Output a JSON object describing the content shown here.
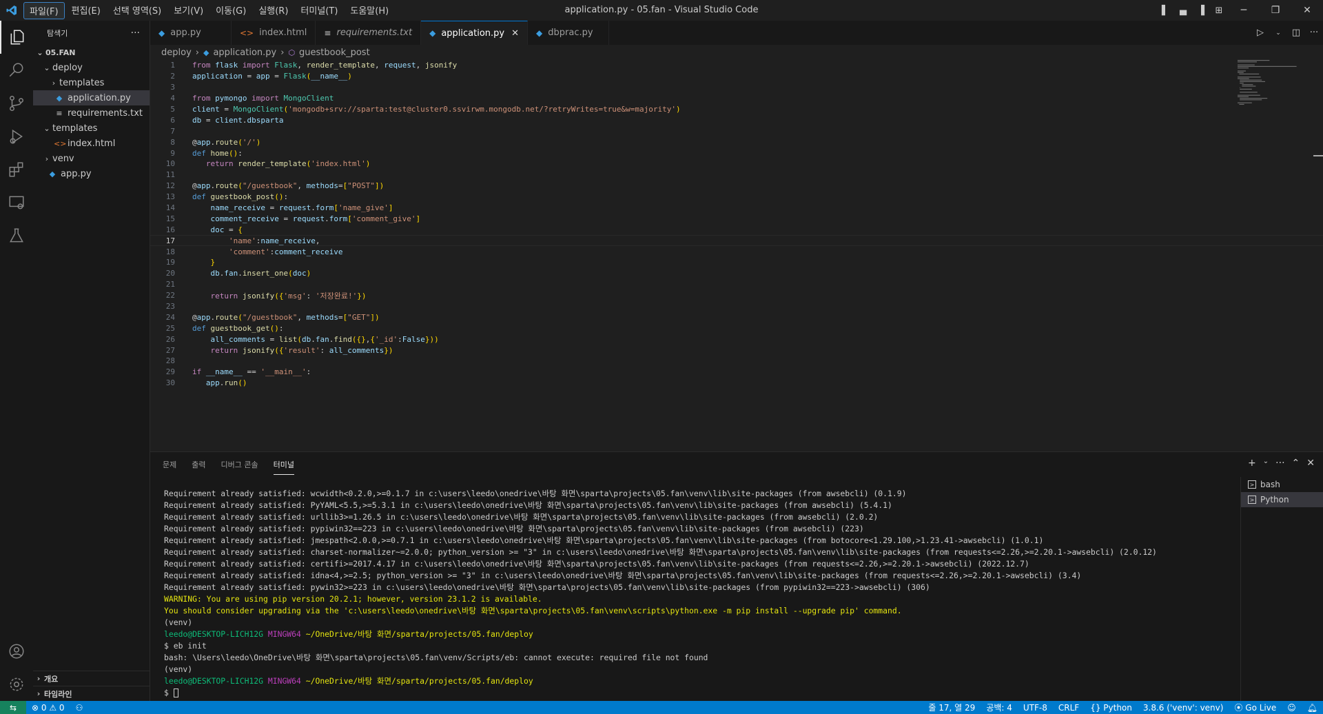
{
  "titlebar": {
    "menus": [
      "파일(F)",
      "편집(E)",
      "선택 영역(S)",
      "보기(V)",
      "이동(G)",
      "실행(R)",
      "터미널(T)",
      "도움말(H)"
    ],
    "window_title": "application.py - 05.fan - Visual Studio Code"
  },
  "sidebar": {
    "header": "탐색기",
    "more": "···",
    "root": "05.FAN",
    "items": [
      {
        "label": "deploy",
        "indent": 1,
        "kind": "folder-open"
      },
      {
        "label": "templates",
        "indent": 2,
        "kind": "folder-closed"
      },
      {
        "label": "application.py",
        "indent": 2,
        "kind": "python",
        "selected": true
      },
      {
        "label": "requirements.txt",
        "indent": 2,
        "kind": "text"
      },
      {
        "label": "templates",
        "indent": 1,
        "kind": "folder-open"
      },
      {
        "label": "index.html",
        "indent": 2,
        "kind": "html"
      },
      {
        "label": "venv",
        "indent": 1,
        "kind": "folder-closed"
      },
      {
        "label": "app.py",
        "indent": 1,
        "kind": "python"
      }
    ],
    "bottom_sections": [
      "개요",
      "타임라인"
    ]
  },
  "tabs": [
    {
      "label": "app.py",
      "kind": "python"
    },
    {
      "label": "index.html",
      "kind": "html"
    },
    {
      "label": "requirements.txt",
      "kind": "text"
    },
    {
      "label": "application.py",
      "kind": "python",
      "active": true
    },
    {
      "label": "dbprac.py",
      "kind": "python"
    }
  ],
  "breadcrumb": [
    "deploy",
    "application.py",
    "guestbook_post"
  ],
  "editor": {
    "current_line": 17,
    "lines": [
      "from flask import Flask, render_template, request, jsonify",
      "application = app = Flask(__name__)",
      "",
      "from pymongo import MongoClient",
      "client = MongoClient('mongodb+srv://sparta:test@cluster0.ssvirwm.mongodb.net/?retryWrites=true&w=majority')",
      "db = client.dbsparta",
      "",
      "@app.route('/')",
      "def home():",
      "   return render_template('index.html')",
      "",
      "@app.route(\"/guestbook\", methods=[\"POST\"])",
      "def guestbook_post():",
      "    name_receive = request.form['name_give']",
      "    comment_receive = request.form['comment_give']",
      "    doc = {",
      "        'name':name_receive,",
      "        'comment':comment_receive",
      "    }",
      "    db.fan.insert_one(doc)",
      "",
      "    return jsonify({'msg': '저장완료!'})",
      "",
      "@app.route(\"/guestbook\", methods=[\"GET\"])",
      "def guestbook_get():",
      "    all_comments = list(db.fan.find({},{'_id':False}))",
      "    return jsonify({'result': all_comments})",
      "",
      "if __name__ == '__main__':",
      "   app.run()"
    ]
  },
  "panel": {
    "tabs": [
      "문제",
      "출력",
      "디버그 콘솔",
      "터미널"
    ],
    "active_tab": "터미널",
    "terminal_lines": [
      {
        "text": "Requirement already satisfied: wcwidth<0.2.0,>=0.1.7 in c:\\users\\leedo\\onedrive\\바탕 화면\\sparta\\projects\\05.fan\\venv\\lib\\site-packages (from awsebcli) (0.1.9)",
        "style": ""
      },
      {
        "text": "Requirement already satisfied: PyYAML<5.5,>=5.3.1 in c:\\users\\leedo\\onedrive\\바탕 화면\\sparta\\projects\\05.fan\\venv\\lib\\site-packages (from awsebcli) (5.4.1)",
        "style": ""
      },
      {
        "text": "Requirement already satisfied: urllib3>=1.26.5 in c:\\users\\leedo\\onedrive\\바탕 화면\\sparta\\projects\\05.fan\\venv\\lib\\site-packages (from awsebcli) (2.0.2)",
        "style": ""
      },
      {
        "text": "Requirement already satisfied: pypiwin32==223 in c:\\users\\leedo\\onedrive\\바탕 화면\\sparta\\projects\\05.fan\\venv\\lib\\site-packages (from awsebcli) (223)",
        "style": ""
      },
      {
        "text": "Requirement already satisfied: jmespath<2.0.0,>=0.7.1 in c:\\users\\leedo\\onedrive\\바탕 화면\\sparta\\projects\\05.fan\\venv\\lib\\site-packages (from botocore<1.29.100,>1.23.41->awsebcli) (1.0.1)",
        "style": ""
      },
      {
        "text": "Requirement already satisfied: charset-normalizer~=2.0.0; python_version >= \"3\" in c:\\users\\leedo\\onedrive\\바탕 화면\\sparta\\projects\\05.fan\\venv\\lib\\site-packages (from requests<=2.26,>=2.20.1->awsebcli) (2.0.12)",
        "style": ""
      },
      {
        "text": "Requirement already satisfied: certifi>=2017.4.17 in c:\\users\\leedo\\onedrive\\바탕 화면\\sparta\\projects\\05.fan\\venv\\lib\\site-packages (from requests<=2.26,>=2.20.1->awsebcli) (2022.12.7)",
        "style": ""
      },
      {
        "text": "Requirement already satisfied: idna<4,>=2.5; python_version >= \"3\" in c:\\users\\leedo\\onedrive\\바탕 화면\\sparta\\projects\\05.fan\\venv\\lib\\site-packages (from requests<=2.26,>=2.20.1->awsebcli) (3.4)",
        "style": ""
      },
      {
        "text": "Requirement already satisfied: pywin32>=223 in c:\\users\\leedo\\onedrive\\바탕 화면\\sparta\\projects\\05.fan\\venv\\lib\\site-packages (from pypiwin32==223->awsebcli) (306)",
        "style": ""
      },
      {
        "text": "WARNING: You are using pip version 20.2.1; however, version 23.1.2 is available.",
        "style": "warn"
      },
      {
        "text": "You should consider upgrading via the 'c:\\users\\leedo\\onedrive\\바탕 화면\\sparta\\projects\\05.fan\\venv\\scripts\\python.exe -m pip install --upgrade pip' command.",
        "style": "warn"
      },
      {
        "text": "(venv)",
        "style": ""
      },
      {
        "text": "",
        "style": "prompt",
        "user": "leedo@DESKTOP-LICH12G",
        "shell": "MINGW64",
        "path": "~/OneDrive/바탕 화면/sparta/projects/05.fan/deploy"
      },
      {
        "text": "$ eb init",
        "style": ""
      },
      {
        "text": "bash: \\Users\\leedo\\OneDrive\\바탕 화면\\sparta\\projects\\05.fan\\venv/Scripts/eb: cannot execute: required file not found",
        "style": ""
      },
      {
        "text": "(venv)",
        "style": ""
      },
      {
        "text": "",
        "style": "prompt",
        "user": "leedo@DESKTOP-LICH12G",
        "shell": "MINGW64",
        "path": "~/OneDrive/바탕 화면/sparta/projects/05.fan/deploy"
      },
      {
        "text": "$ ",
        "style": "cursor"
      }
    ],
    "terminals": [
      {
        "label": "bash"
      },
      {
        "label": "Python",
        "active": true
      }
    ]
  },
  "statusbar": {
    "errors": "0",
    "warnings": "0",
    "position": "줄 17, 열 29",
    "spaces": "공백: 4",
    "encoding": "UTF-8",
    "eol": "CRLF",
    "language": "Python",
    "interpreter": "3.8.6 ('venv': venv)",
    "golive": "Go Live"
  },
  "colors": {
    "accent": "#007acc",
    "remote": "#16825d"
  }
}
